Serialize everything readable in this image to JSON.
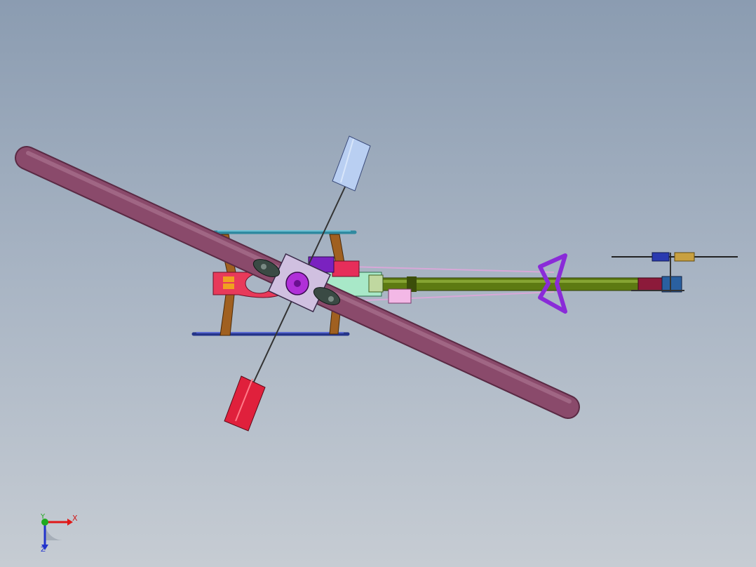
{
  "viewport": {
    "background_top": "#8b9cb1",
    "background_bottom": "#c6ccd3"
  },
  "model": {
    "main_blade_color": "#8a4a6b",
    "flybar_paddle_upper_color": "#b9cff2",
    "flybar_paddle_lower_color": "#e0203c",
    "tail_boom_color": "#5d7a12",
    "tail_fin_color": "#8a2bd8",
    "canopy_front_color": "#e83a5a",
    "skid_upper_color": "#2f8aa0",
    "skid_lower_color": "#24348a",
    "skid_strut_color": "#a06020"
  },
  "triad": {
    "x_label": "X",
    "y_label": "Y",
    "z_label": "Z",
    "x_color": "#e01818",
    "y_color": "#1faa1f",
    "z_color": "#2233cc"
  }
}
